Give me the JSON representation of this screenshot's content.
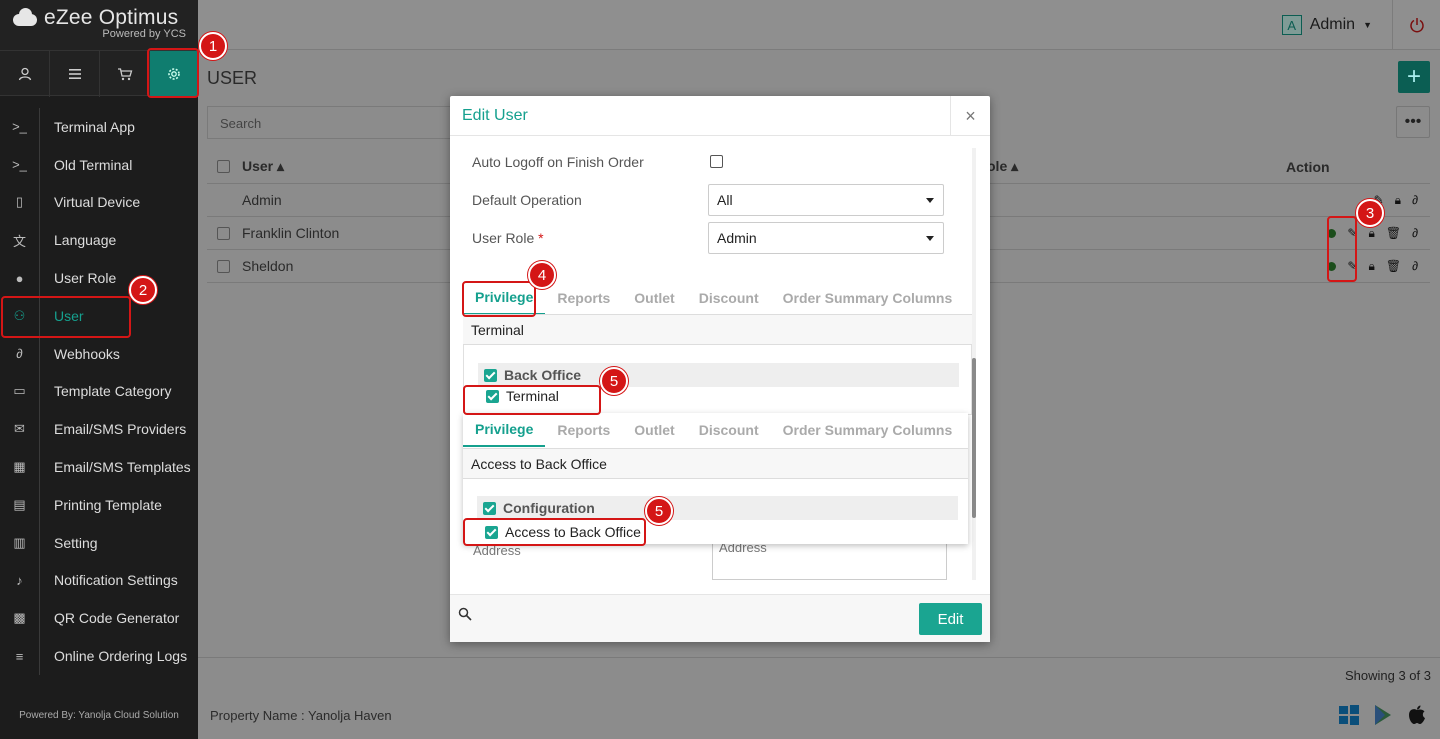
{
  "brand": {
    "name": "eZee Optimus",
    "tagline": "Powered by YCS"
  },
  "top_icons": [
    "user-icon",
    "menu-icon",
    "cart-icon",
    "gear-icon"
  ],
  "menu": {
    "items": [
      {
        "label": "Terminal App",
        "icon": "terminal-icon"
      },
      {
        "label": "Old Terminal",
        "icon": "terminal-icon"
      },
      {
        "label": "Virtual Device",
        "icon": "tablet-icon"
      },
      {
        "label": "Language",
        "icon": "language-icon"
      },
      {
        "label": "User Role",
        "icon": "user-role-icon"
      },
      {
        "label": "User",
        "icon": "user-icon"
      },
      {
        "label": "Webhooks",
        "icon": "link-icon"
      },
      {
        "label": "Template Category",
        "icon": "inbox-icon"
      },
      {
        "label": "Email/SMS Providers",
        "icon": "envelope-icon"
      },
      {
        "label": "Email/SMS Templates",
        "icon": "calendar-icon"
      },
      {
        "label": "Printing Template",
        "icon": "document-icon"
      },
      {
        "label": "Setting",
        "icon": "setting-icon"
      },
      {
        "label": "Notification Settings",
        "icon": "bell-icon"
      },
      {
        "label": "QR Code Generator",
        "icon": "qr-icon"
      },
      {
        "label": "Online Ordering Logs",
        "icon": "list-icon"
      }
    ],
    "active_index": 5
  },
  "sidebar_footer": "Powered By: Yanolja Cloud Solution",
  "header": {
    "admin_badge": "A",
    "admin_label": "Admin"
  },
  "page": {
    "title": "USER",
    "add_label": "+",
    "more_label": "•••",
    "search_placeholder": "Search",
    "columns": {
      "user": "User",
      "role": "ole",
      "action": "Action"
    },
    "rows": [
      {
        "name": "Admin"
      },
      {
        "name": "Franklin Clinton"
      },
      {
        "name": "Sheldon"
      }
    ],
    "showing": "Showing 3 of 3",
    "property": "Property Name : Yanolja Haven"
  },
  "modal": {
    "title": "Edit User",
    "close": "×",
    "auto_logoff_label": "Auto Logoff on Finish Order",
    "default_operation_label": "Default Operation",
    "default_operation_value": "All",
    "user_role_label": "User Role",
    "user_role_req": "*",
    "user_role_value": "Admin",
    "tabs": [
      "Privilege",
      "Reports",
      "Outlet",
      "Discount",
      "Order Summary Columns"
    ],
    "subheader": "Terminal",
    "tree_head": "Back Office",
    "tree_child": "Terminal",
    "address_label": "Address",
    "address_placeholder": "Address",
    "edit_label": "Edit"
  },
  "overlay": {
    "tabs": [
      "Privilege",
      "Reports",
      "Outlet",
      "Discount",
      "Order Summary Columns"
    ],
    "subheader": "Access to Back Office",
    "tree_head": "Configuration",
    "tree_child": "Access to Back Office"
  },
  "annotations": [
    "1",
    "2",
    "3",
    "4",
    "5",
    "5"
  ],
  "colors": {
    "accent": "#15a08e",
    "annotation": "#d41616",
    "sidebar": "#1c1c1c"
  }
}
